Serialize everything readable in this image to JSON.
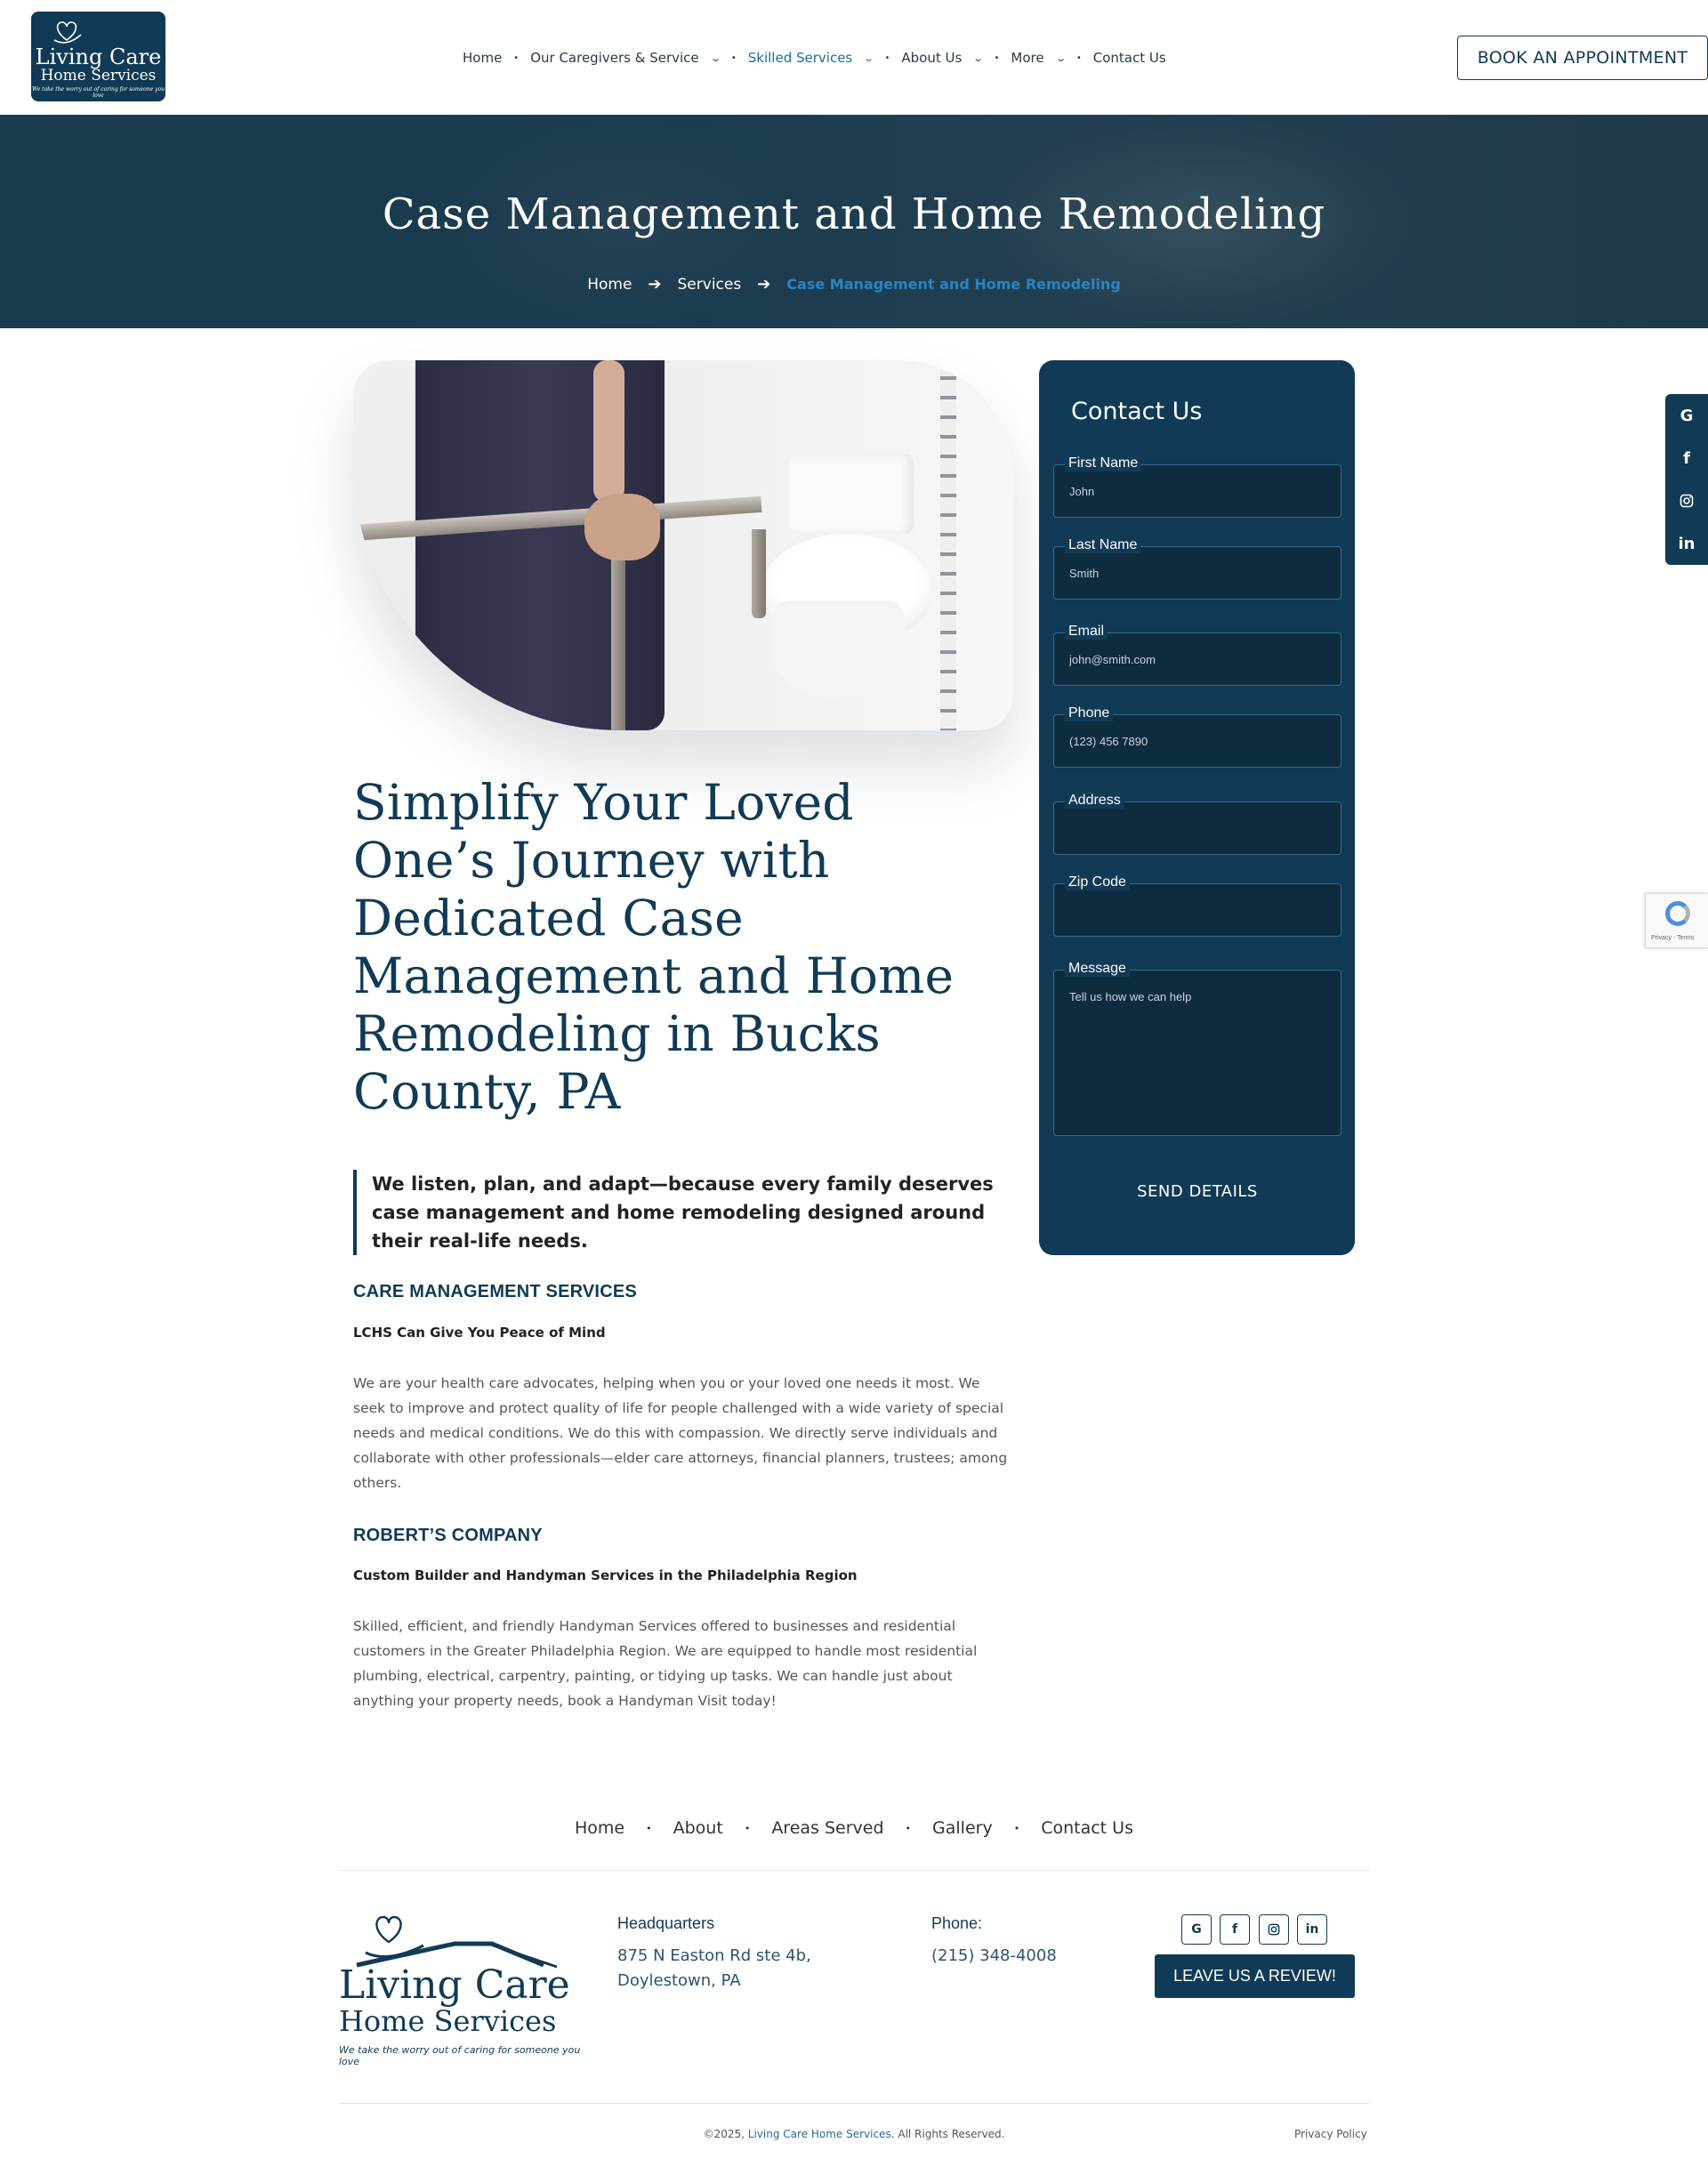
{
  "logo": {
    "line1": "Living Care",
    "line2": "Home Services",
    "tagline": "We take the worry out of caring for someone you love"
  },
  "nav": {
    "items": [
      "Home",
      "Our Caregivers & Service",
      "Skilled Services",
      "About Us",
      "More",
      "Contact Us"
    ],
    "active": "Skilled Services"
  },
  "book_button": "BOOK AN APPOINTMENT",
  "hero": {
    "title": "Case Management and Home Remodeling",
    "breadcrumb": [
      "Home",
      "Services",
      "Case Management and Home Remodeling"
    ]
  },
  "main": {
    "headline": "Simplify Your Loved One’s Journey with Dedicated Case Management and Home Remodeling in Bucks County, PA",
    "quote": "We listen, plan, and adapt—because every family deserves case management and home remodeling designed around their real-life needs.",
    "section1": {
      "title": "CARE MANAGEMENT SERVICES",
      "subtitle": "LCHS Can Give You Peace of Mind",
      "body": "We are your health care advocates, helping when you or your loved one needs it most. We seek to improve and protect quality of life for people challenged with a wide variety of special needs and medical conditions. We do this with compassion. We directly serve individuals and collaborate with other professionals—elder care attorneys, financial planners, trustees; among others."
    },
    "section2": {
      "title": "ROBERT’S COMPANY",
      "subtitle": "Custom Builder and Handyman Services in the Philadelphia Region",
      "body": "Skilled, efficient, and friendly Handyman Services offered to businesses and residential customers in the Greater Philadelphia Region. We are equipped to handle most residential plumbing, electrical, carpentry, painting, or tidying up tasks. We can handle just about anything your property needs, book a Handyman Visit today!"
    }
  },
  "contact": {
    "title": "Contact Us",
    "fields": {
      "first_name": {
        "label": "First Name",
        "placeholder": "John"
      },
      "last_name": {
        "label": "Last Name",
        "placeholder": "Smith"
      },
      "email": {
        "label": "Email",
        "placeholder": "john@smith.com"
      },
      "phone": {
        "label": "Phone",
        "placeholder": "(123) 456 7890"
      },
      "address": {
        "label": "Address",
        "placeholder": ""
      },
      "zip": {
        "label": "Zip Code",
        "placeholder": ""
      },
      "message": {
        "label": "Message",
        "placeholder": "Tell us how we can help"
      }
    },
    "submit": "SEND DETAILS"
  },
  "floating_social": [
    "google-icon",
    "facebook-icon",
    "instagram-icon",
    "linkedin-icon"
  ],
  "recaptcha": {
    "text": "Privacy - Terms"
  },
  "footer": {
    "nav": [
      "Home",
      "About",
      "Areas Served",
      "Gallery",
      "Contact Us"
    ],
    "hq_label": "Headquarters",
    "hq_line1": "875 N Easton Rd ste 4b,",
    "hq_line2": "Doylestown, PA",
    "phone_label": "Phone:",
    "phone": "(215) 348-4008",
    "review_button": "LEAVE US A REVIEW!",
    "copyright_prefix": "©2025, ",
    "copyright_brand": "Living Care Home Services",
    "copyright_suffix": ". All Rights Reserved.",
    "privacy": "Privacy Policy"
  },
  "colors": {
    "brand_navy": "#103a55",
    "accent_blue": "#2a85c2"
  }
}
